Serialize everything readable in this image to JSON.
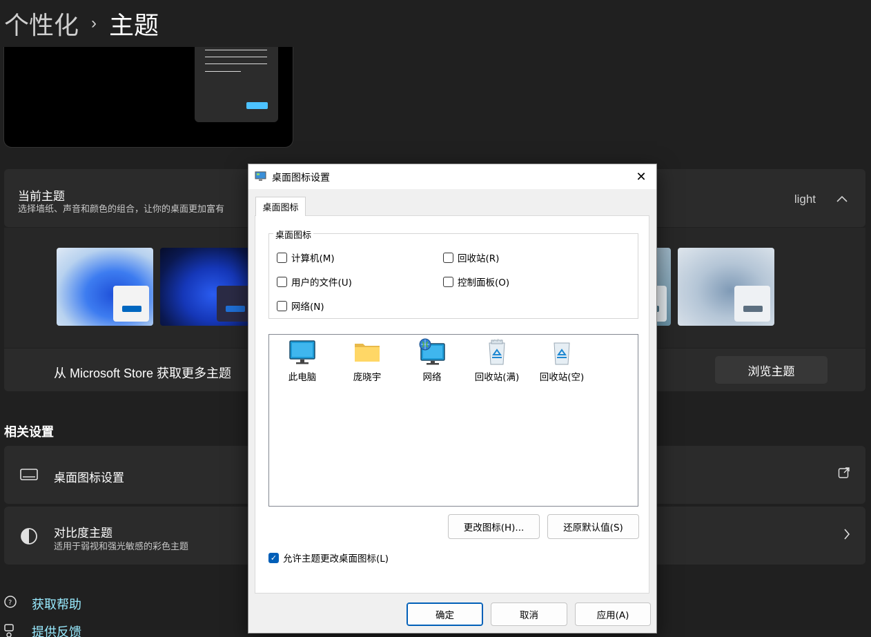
{
  "settings": {
    "breadcrumb_parent": "个性化",
    "breadcrumb_separator": "›",
    "page_title": "主题",
    "current_theme": {
      "title": "当前主题",
      "subtitle": "选择墙纸、声音和颜色的组合，让你的桌面更加富有",
      "value": "light"
    },
    "store_row": {
      "text": "从 Microsoft Store 获取更多主题",
      "browse_button": "浏览主题"
    },
    "related_title": "相关设置",
    "desktop_icons_row": {
      "label": "桌面图标设置"
    },
    "contrast_row": {
      "label": "对比度主题",
      "subtitle": "适用于弱视和强光敏感的彩色主题"
    },
    "help_link": "获取帮助",
    "feedback_link": "提供反馈"
  },
  "dialog": {
    "title": "桌面图标设置",
    "close_glyph": "✕",
    "tab": "桌面图标",
    "group_legend": "桌面图标",
    "checkboxes": [
      {
        "label": "计算机(M)",
        "checked": false
      },
      {
        "label": "回收站(R)",
        "checked": false
      },
      {
        "label": "用户的文件(U)",
        "checked": false
      },
      {
        "label": "控制面板(O)",
        "checked": false
      },
      {
        "label": "网络(N)",
        "checked": false
      }
    ],
    "icons": [
      {
        "label": "此电脑",
        "icon": "monitor-icon"
      },
      {
        "label": "庞晓宇",
        "icon": "folder-icon"
      },
      {
        "label": "网络",
        "icon": "network-icon"
      },
      {
        "label": "回收站(满)",
        "icon": "recycle-bin-full-icon"
      },
      {
        "label": "回收站(空)",
        "icon": "recycle-bin-empty-icon"
      }
    ],
    "change_icon_button": "更改图标(H)...",
    "restore_default_button": "还原默认值(S)",
    "allow_themes_checkbox": {
      "label": "允许主题更改桌面图标(L)",
      "checked": true
    },
    "ok_button": "确定",
    "cancel_button": "取消",
    "apply_button": "应用(A)"
  },
  "colors": {
    "accent": "#005fb8",
    "link": "#99ebff",
    "background": "#202020",
    "card": "#2b2b2b"
  }
}
